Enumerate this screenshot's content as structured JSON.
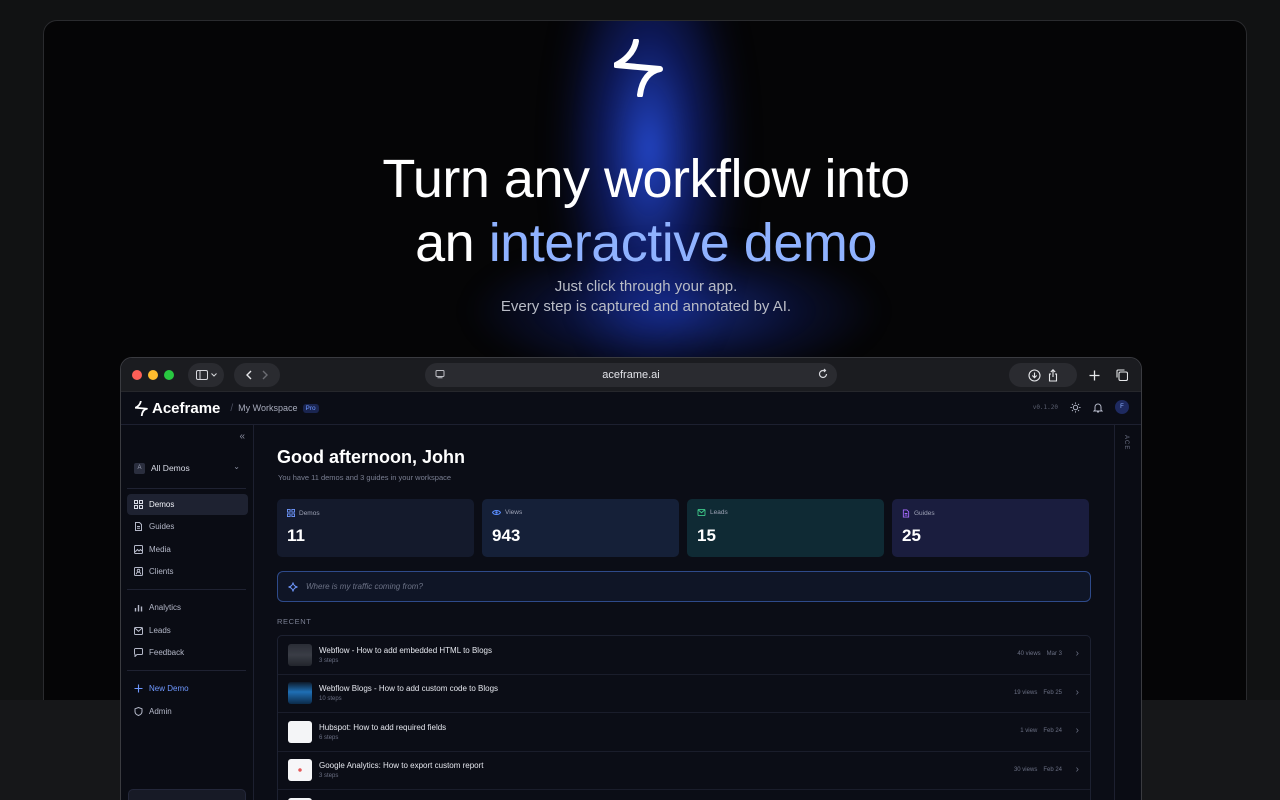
{
  "hero": {
    "title_line1": "Turn any workflow into",
    "title_line2_plain": "an ",
    "title_line2_accent": "interactive demo",
    "subtitle_line1": "Just click through your app.",
    "subtitle_line2": "Every step is captured and annotated by AI."
  },
  "browser": {
    "url": "aceframe.ai"
  },
  "app": {
    "brand": "Aceframe",
    "breadcrumb_sep": "/",
    "workspace": "My Workspace",
    "plan_badge": "Pro",
    "version": "v0.1.20",
    "avatar_initial": "F",
    "right_rail_label": "ACE"
  },
  "sidebar": {
    "workspace_icon": "A",
    "workspace_selector": "All Demos",
    "items": [
      {
        "label": "Demos"
      },
      {
        "label": "Guides"
      },
      {
        "label": "Media"
      },
      {
        "label": "Clients"
      },
      {
        "label": "Analytics"
      },
      {
        "label": "Leads"
      },
      {
        "label": "Feedback"
      },
      {
        "label": "New Demo"
      },
      {
        "label": "Admin"
      }
    ]
  },
  "main": {
    "greeting": "Good afternoon, John",
    "summary": "You have 11 demos and 3 guides in your workspace",
    "stats": [
      {
        "label": "Demos",
        "value": "11",
        "color": "#6f98ff"
      },
      {
        "label": "Views",
        "value": "943",
        "color": "#5a8dff"
      },
      {
        "label": "Leads",
        "value": "15",
        "color": "#3ec98a"
      },
      {
        "label": "Guides",
        "value": "25",
        "color": "#a56bff"
      }
    ],
    "ask_placeholder": "Where is my traffic coming from?",
    "recent_label": "RECENT",
    "recent": [
      {
        "title": "Webflow - How to add embedded HTML to Blogs",
        "steps": "3 steps",
        "views": "40 views",
        "date": "Mar 3"
      },
      {
        "title": "Webflow Blogs - How to add custom code to Blogs",
        "steps": "10 steps",
        "views": "19 views",
        "date": "Feb 25"
      },
      {
        "title": "Hubspot: How to add required fields",
        "steps": "6 steps",
        "views": "1 view",
        "date": "Feb 24"
      },
      {
        "title": "Google Analytics: How to export custom report",
        "steps": "3 steps",
        "views": "30 views",
        "date": "Feb 24"
      }
    ]
  }
}
